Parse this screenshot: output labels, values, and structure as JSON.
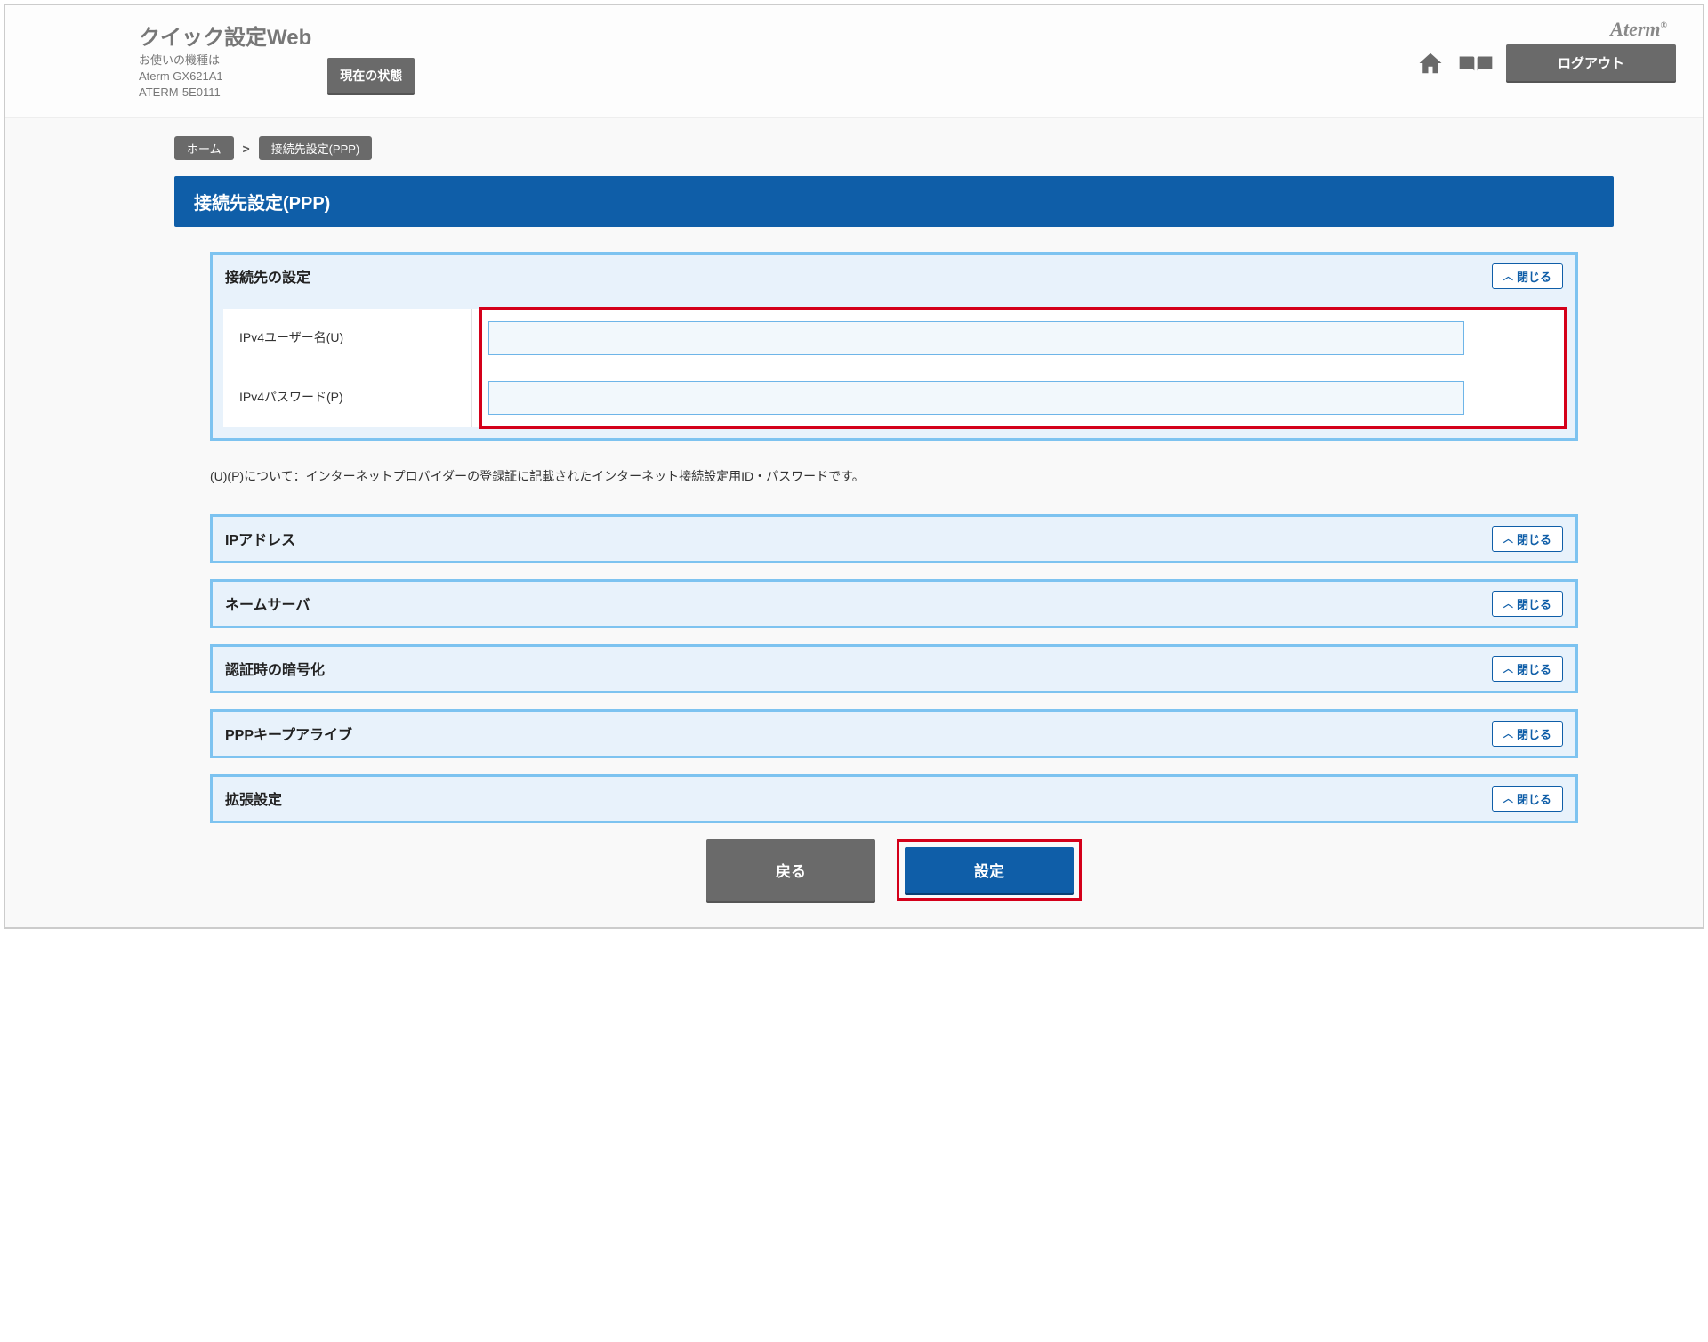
{
  "header": {
    "app_title": "クイック設定Web",
    "device_caption": "お使いの機種は",
    "device_model": "Aterm GX621A1",
    "device_id": "ATERM-5E0111",
    "status_button": "現在の状態",
    "brand": "Aterm",
    "logout": "ログアウト"
  },
  "breadcrumb": {
    "home": "ホーム",
    "sep": ">",
    "current": "接続先設定(PPP)"
  },
  "page_title": "接続先設定(PPP)",
  "panels": {
    "connection": {
      "title": "接続先の設定",
      "close": "閉じる",
      "fields": {
        "user_label": "IPv4ユーザー名(U)",
        "user_value": "",
        "pass_label": "IPv4パスワード(P)",
        "pass_value": ""
      }
    },
    "ip": {
      "title": "IPアドレス",
      "close": "閉じる"
    },
    "nameserver": {
      "title": "ネームサーバ",
      "close": "閉じる"
    },
    "auth": {
      "title": "認証時の暗号化",
      "close": "閉じる"
    },
    "keepalive": {
      "title": "PPPキープアライブ",
      "close": "閉じる"
    },
    "extended": {
      "title": "拡張設定",
      "close": "閉じる"
    }
  },
  "note": "(U)(P)について：インターネットプロバイダーの登録証に記載されたインターネット接続設定用ID・パスワードです。",
  "buttons": {
    "back": "戻る",
    "submit": "設定"
  }
}
